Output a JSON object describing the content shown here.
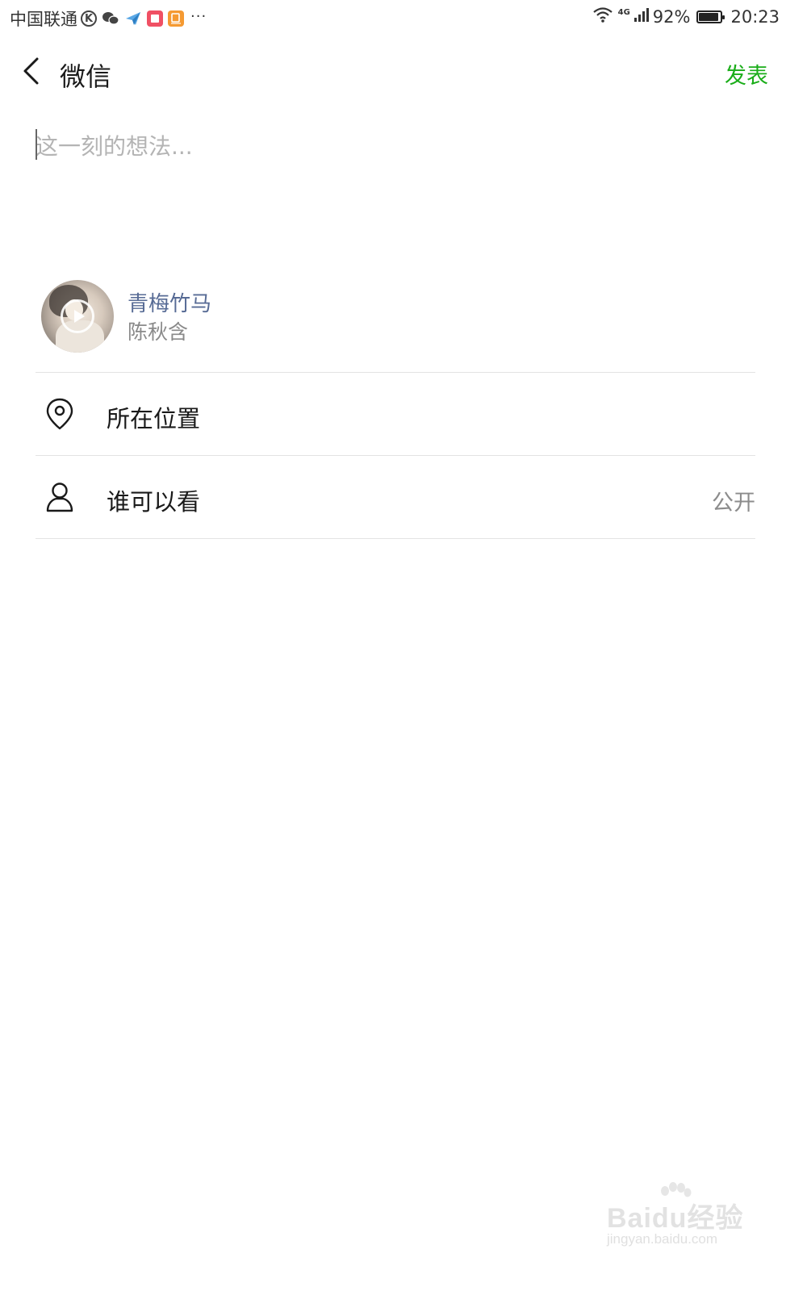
{
  "status_bar": {
    "carrier": "中国联通",
    "k_badge": "K",
    "more": "···",
    "network": "4G",
    "battery_text": "92%",
    "battery_level": 0.92,
    "time": "20:23"
  },
  "nav": {
    "title": "微信",
    "publish_label": "发表",
    "publish_color": "#1aad19"
  },
  "compose": {
    "placeholder": "这一刻的想法...",
    "value": ""
  },
  "music": {
    "title": "青梅竹马",
    "artist": "陈秋含",
    "link_color": "#576b95"
  },
  "options": {
    "location": {
      "icon": "location-pin-icon",
      "label": "所在位置"
    },
    "visibility": {
      "icon": "person-icon",
      "label": "谁可以看",
      "value": "公开"
    }
  },
  "watermark": {
    "brand": "Baidu经验",
    "url": "jingyan.baidu.com"
  }
}
